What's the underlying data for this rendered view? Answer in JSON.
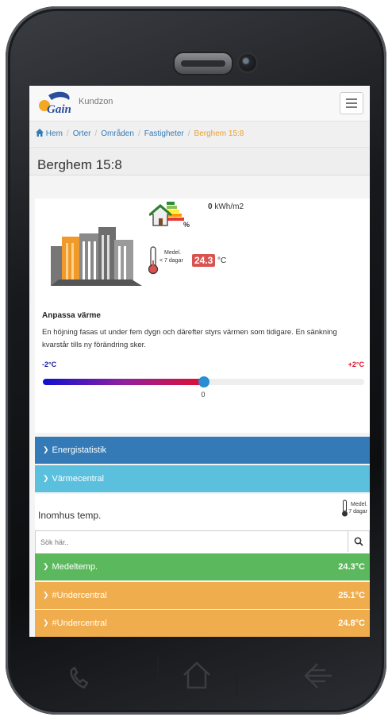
{
  "header": {
    "brand_text": "Kundzon",
    "logo_text": "Gain"
  },
  "breadcrumb": {
    "items": [
      "Hem",
      "Orter",
      "Områden",
      "Fastigheter"
    ],
    "active": "Berghem 15:8",
    "separator": "/"
  },
  "page": {
    "title": "Berghem 15:8"
  },
  "energy": {
    "value": "0",
    "unit": "kWh/m2",
    "percent_symbol": "%"
  },
  "temperature": {
    "label_line1": "Medel.",
    "label_line2": "< 7 dagar",
    "value": "24.3",
    "unit": "°C"
  },
  "adjust": {
    "title": "Anpassa värme",
    "description": "En höjning fasas ut under fem dygn och därefter styrs värmen som tidigare. En sänkning kvarstår tills ny förändring sker.",
    "min_label": "-2°C",
    "max_label": "+2°C",
    "value_label": "0",
    "value": 0.5
  },
  "sections": [
    {
      "label": "Energistatistik",
      "color": "#337ab7"
    },
    {
      "label": "Värmecentral",
      "color": "#5bc0de"
    }
  ],
  "indoor": {
    "title": "Inomhus temp.",
    "medel_line1": "Medel.",
    "medel_line2": "< 7 dagar",
    "search_placeholder": "Sök här.."
  },
  "readings": [
    {
      "label": "Medeltemp.",
      "value": "24.3°C",
      "color": "#5cb85c"
    },
    {
      "label": "#Undercentral",
      "value": "25.1°C",
      "color": "#f0ad4e"
    },
    {
      "label": "#Undercentral",
      "value": "24.8°C",
      "color": "#f0ad4e"
    }
  ],
  "icons": [
    "home-icon",
    "thermometer-icon",
    "energy-house-icon",
    "buildings-icon",
    "search-icon",
    "chevron-down-icon",
    "menu-icon",
    "back-icon",
    "home-key-icon",
    "phone-key-icon"
  ]
}
